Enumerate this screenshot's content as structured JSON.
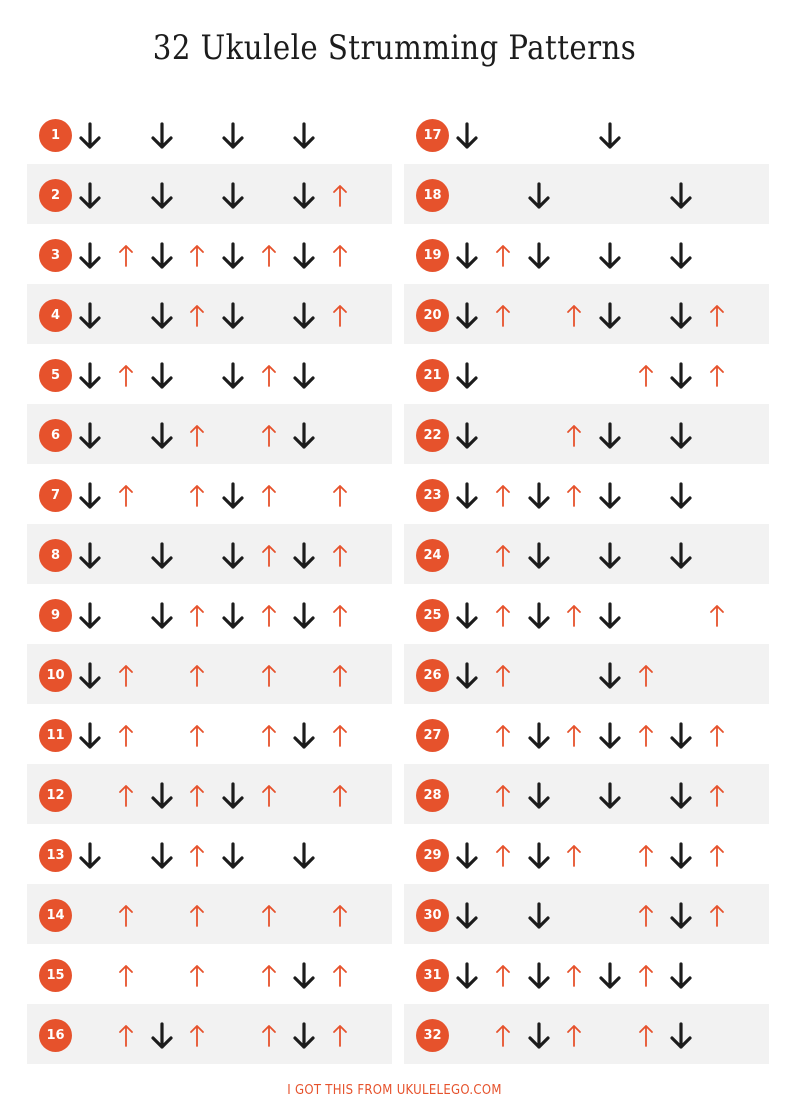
{
  "title": "32 Ukulele Strumming Patterns",
  "footer": "I GOT THIS FROM UKULELEGO.COM",
  "colors": {
    "accent": "#e6522c",
    "down_arrow": "#1c1c1c",
    "up_arrow": "#e6522c",
    "row_shade": "#f2f2f2"
  },
  "icons": {
    "down": "down-strum-arrow-icon",
    "up": "up-strum-arrow-icon"
  },
  "patterns": [
    {
      "number": "1",
      "strums": [
        "D",
        "",
        "D",
        "",
        "D",
        "",
        "D",
        ""
      ]
    },
    {
      "number": "2",
      "strums": [
        "D",
        "",
        "D",
        "",
        "D",
        "",
        "D",
        "U"
      ]
    },
    {
      "number": "3",
      "strums": [
        "D",
        "U",
        "D",
        "U",
        "D",
        "U",
        "D",
        "U"
      ]
    },
    {
      "number": "4",
      "strums": [
        "D",
        "",
        "D",
        "U",
        "D",
        "",
        "D",
        "U"
      ]
    },
    {
      "number": "5",
      "strums": [
        "D",
        "U",
        "D",
        "",
        "D",
        "U",
        "D",
        ""
      ]
    },
    {
      "number": "6",
      "strums": [
        "D",
        "",
        "D",
        "U",
        "",
        "U",
        "D",
        ""
      ]
    },
    {
      "number": "7",
      "strums": [
        "D",
        "U",
        "",
        "U",
        "D",
        "U",
        "",
        "U"
      ]
    },
    {
      "number": "8",
      "strums": [
        "D",
        "",
        "D",
        "",
        "D",
        "U",
        "D",
        "U"
      ]
    },
    {
      "number": "9",
      "strums": [
        "D",
        "",
        "D",
        "U",
        "D",
        "U",
        "D",
        "U"
      ]
    },
    {
      "number": "10",
      "strums": [
        "D",
        "U",
        "",
        "U",
        "",
        "U",
        "",
        "U"
      ]
    },
    {
      "number": "11",
      "strums": [
        "D",
        "U",
        "",
        "U",
        "",
        "U",
        "D",
        "U"
      ]
    },
    {
      "number": "12",
      "strums": [
        "",
        "U",
        "D",
        "U",
        "D",
        "U",
        "",
        "U"
      ]
    },
    {
      "number": "13",
      "strums": [
        "D",
        "",
        "D",
        "U",
        "D",
        "",
        "D",
        ""
      ]
    },
    {
      "number": "14",
      "strums": [
        "",
        "U",
        "",
        "U",
        "",
        "U",
        "",
        "U"
      ]
    },
    {
      "number": "15",
      "strums": [
        "",
        "U",
        "",
        "U",
        "",
        "U",
        "D",
        "U"
      ]
    },
    {
      "number": "16",
      "strums": [
        "",
        "U",
        "D",
        "U",
        "",
        "U",
        "D",
        "U"
      ]
    },
    {
      "number": "17",
      "strums": [
        "D",
        "",
        "",
        "",
        "D",
        "",
        "",
        ""
      ]
    },
    {
      "number": "18",
      "strums": [
        "",
        "",
        "D",
        "",
        "",
        "",
        "D",
        ""
      ]
    },
    {
      "number": "19",
      "strums": [
        "D",
        "U",
        "D",
        "",
        "D",
        "",
        "D",
        ""
      ]
    },
    {
      "number": "20",
      "strums": [
        "D",
        "U",
        "",
        "U",
        "D",
        "",
        "D",
        "U"
      ]
    },
    {
      "number": "21",
      "strums": [
        "D",
        "",
        "",
        "",
        "",
        "U",
        "D",
        "U"
      ]
    },
    {
      "number": "22",
      "strums": [
        "D",
        "",
        "",
        "U",
        "D",
        "",
        "D",
        ""
      ]
    },
    {
      "number": "23",
      "strums": [
        "D",
        "U",
        "D",
        "U",
        "D",
        "",
        "D",
        ""
      ]
    },
    {
      "number": "24",
      "strums": [
        "",
        "U",
        "D",
        "",
        "D",
        "",
        "D",
        ""
      ]
    },
    {
      "number": "25",
      "strums": [
        "D",
        "U",
        "D",
        "U",
        "D",
        "",
        "",
        "U"
      ]
    },
    {
      "number": "26",
      "strums": [
        "D",
        "U",
        "",
        "",
        "D",
        "U",
        "",
        ""
      ]
    },
    {
      "number": "27",
      "strums": [
        "",
        "U",
        "D",
        "U",
        "D",
        "U",
        "D",
        "U"
      ]
    },
    {
      "number": "28",
      "strums": [
        "",
        "U",
        "D",
        "",
        "D",
        "",
        "D",
        "U"
      ]
    },
    {
      "number": "29",
      "strums": [
        "D",
        "U",
        "D",
        "U",
        "",
        "U",
        "D",
        "U"
      ]
    },
    {
      "number": "30",
      "strums": [
        "D",
        "",
        "D",
        "",
        "",
        "U",
        "D",
        "U"
      ]
    },
    {
      "number": "31",
      "strums": [
        "D",
        "U",
        "D",
        "U",
        "D",
        "U",
        "D",
        ""
      ]
    },
    {
      "number": "32",
      "strums": [
        "",
        "U",
        "D",
        "U",
        "",
        "U",
        "D",
        ""
      ]
    }
  ]
}
